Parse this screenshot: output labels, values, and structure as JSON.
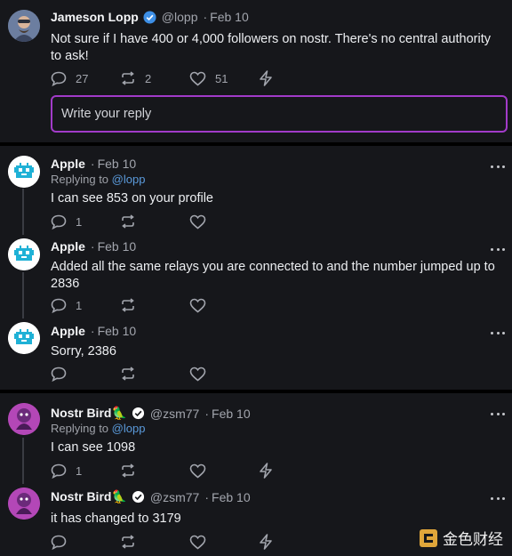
{
  "main_post": {
    "author_name": "Jameson Lopp",
    "handle": "@lopp",
    "date": "Feb 10",
    "text": "Not sure if I have 400 or 4,000 followers on nostr. There's no central authority to ask!",
    "replies": "27",
    "reposts": "2",
    "likes": "51",
    "avatar_icon": "user-avatar-icon"
  },
  "reply_box": {
    "placeholder": "Write your reply"
  },
  "thread_apple": [
    {
      "author_name": "Apple",
      "date": "Feb 10",
      "replying_label": "Replying to",
      "replying_to": "@lopp",
      "text": "I can see 853 on your profile",
      "replies": "1"
    },
    {
      "author_name": "Apple",
      "date": "Feb 10",
      "text": "Added all the same relays you are connected to and the number jumped up to 2836",
      "replies": "1"
    },
    {
      "author_name": "Apple",
      "date": "Feb 10",
      "text": "Sorry, 2386"
    }
  ],
  "thread_bird": [
    {
      "author_name": "Nostr Bird🦜",
      "handle": "@zsm77",
      "date": "Feb 10",
      "replying_label": "Replying to",
      "replying_to": "@lopp",
      "text": "I can  see 1098",
      "replies": "1"
    },
    {
      "author_name": "Nostr Bird🦜",
      "handle": "@zsm77",
      "date": "Feb 10",
      "text": "it has changed to 3179"
    }
  ],
  "watermark": {
    "label": "金色财经"
  },
  "colors": {
    "background": "#16171b",
    "accent": "#a23bc9",
    "link": "#5b9bdc",
    "verified": "#3d8fe6"
  }
}
